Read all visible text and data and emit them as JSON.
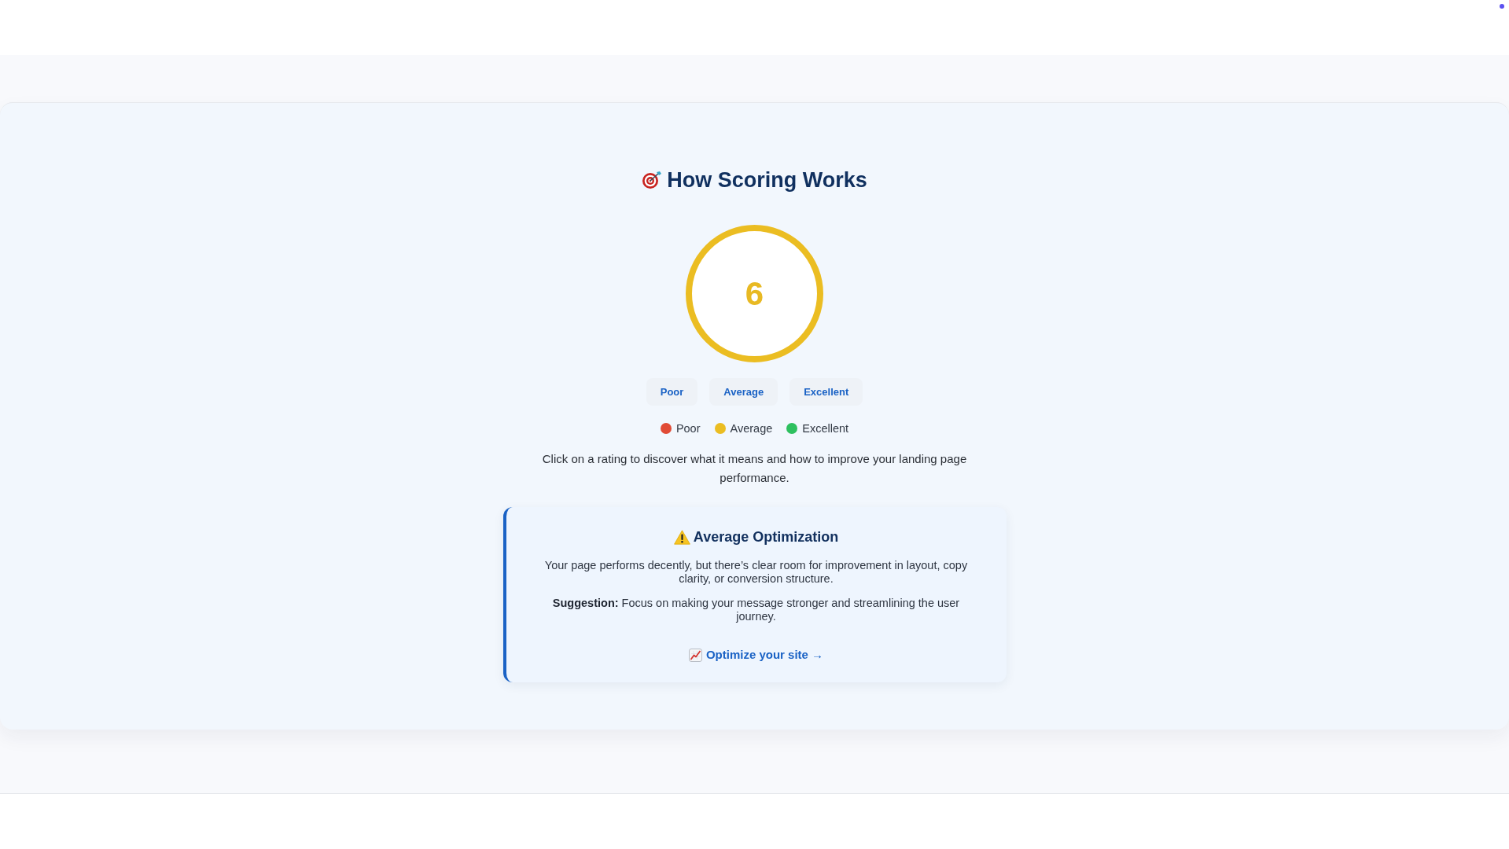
{
  "header": {
    "title": "How Scoring Works"
  },
  "score": {
    "value": "6"
  },
  "rating_buttons": [
    {
      "label": "Poor",
      "selected": false
    },
    {
      "label": "Average",
      "selected": false
    },
    {
      "label": "Excellent",
      "selected": false
    }
  ],
  "legend": [
    {
      "label": "Poor",
      "color": "#e14b36"
    },
    {
      "label": "Average",
      "color": "#ebbd22"
    },
    {
      "label": "Excellent",
      "color": "#2ec05f"
    }
  ],
  "instructions": "Click on a rating to discover what it means and how to improve your landing page performance.",
  "detail_card": {
    "title": "Average Optimization",
    "description": "Your page performs decently, but there’s clear room for improvement in layout, copy clarity, or conversion structure.",
    "suggestion": "**Suggestion:** Focus on making your message stronger and streamlining the user journey.",
    "link": "Optimize your site →"
  }
}
